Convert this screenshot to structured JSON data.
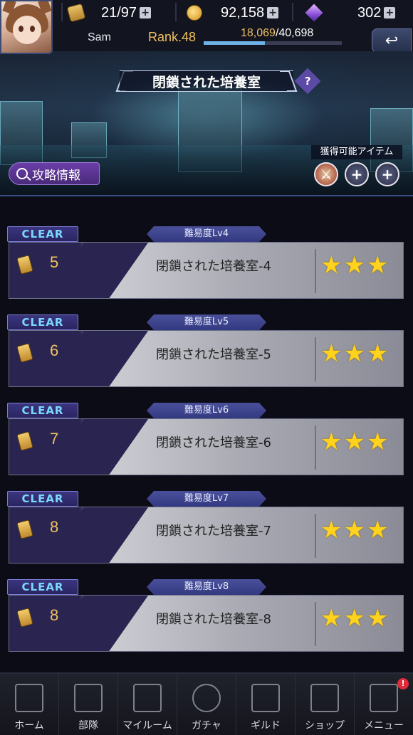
{
  "player": {
    "name": "Sam",
    "rank": "Rank.48",
    "exp_current": "18,069",
    "exp_max": "/40,698",
    "exp_fraction": 0.444,
    "avatar_icon": "player-avatar-icon"
  },
  "resources": {
    "stamina": "21/97",
    "coins": "92,158",
    "gems": "302"
  },
  "stage_header": {
    "title": "閉鎖された培養室",
    "help_label": "?",
    "strategy_label": "攻略情報",
    "items_label": "獲得可能アイテム"
  },
  "items": [
    {
      "icon": "sword-icon",
      "glyph": "⚔"
    },
    {
      "icon": "exp-up-icon",
      "glyph": "+"
    },
    {
      "icon": "plus-icon",
      "glyph": "+"
    }
  ],
  "stages": [
    {
      "clear": "CLEAR",
      "level": "難易度Lv4",
      "cost": "5",
      "name": "閉鎖された培養室-4",
      "stars": 3
    },
    {
      "clear": "CLEAR",
      "level": "難易度Lv5",
      "cost": "6",
      "name": "閉鎖された培養室-5",
      "stars": 3
    },
    {
      "clear": "CLEAR",
      "level": "難易度Lv6",
      "cost": "7",
      "name": "閉鎖された培養室-6",
      "stars": 3
    },
    {
      "clear": "CLEAR",
      "level": "難易度Lv7",
      "cost": "8",
      "name": "閉鎖された培養室-7",
      "stars": 3
    },
    {
      "clear": "CLEAR",
      "level": "難易度Lv8",
      "cost": "8",
      "name": "閉鎖された培養室-8",
      "stars": 3
    }
  ],
  "nav": [
    {
      "label": "ホーム",
      "icon": "home-icon"
    },
    {
      "label": "部隊",
      "icon": "squad-icon"
    },
    {
      "label": "マイルーム",
      "icon": "my-room-icon"
    },
    {
      "label": "ガチャ",
      "icon": "gacha-icon"
    },
    {
      "label": "ギルド",
      "icon": "guild-icon"
    },
    {
      "label": "ショップ",
      "icon": "shop-cart-icon"
    },
    {
      "label": "メニュー",
      "icon": "menu-grid-icon",
      "badge": "!"
    }
  ],
  "colors": {
    "accent_gold": "#f0c060",
    "clear_text": "#7ad8ff",
    "star": "#ffd21e",
    "panel_purple": "#2a2450"
  }
}
